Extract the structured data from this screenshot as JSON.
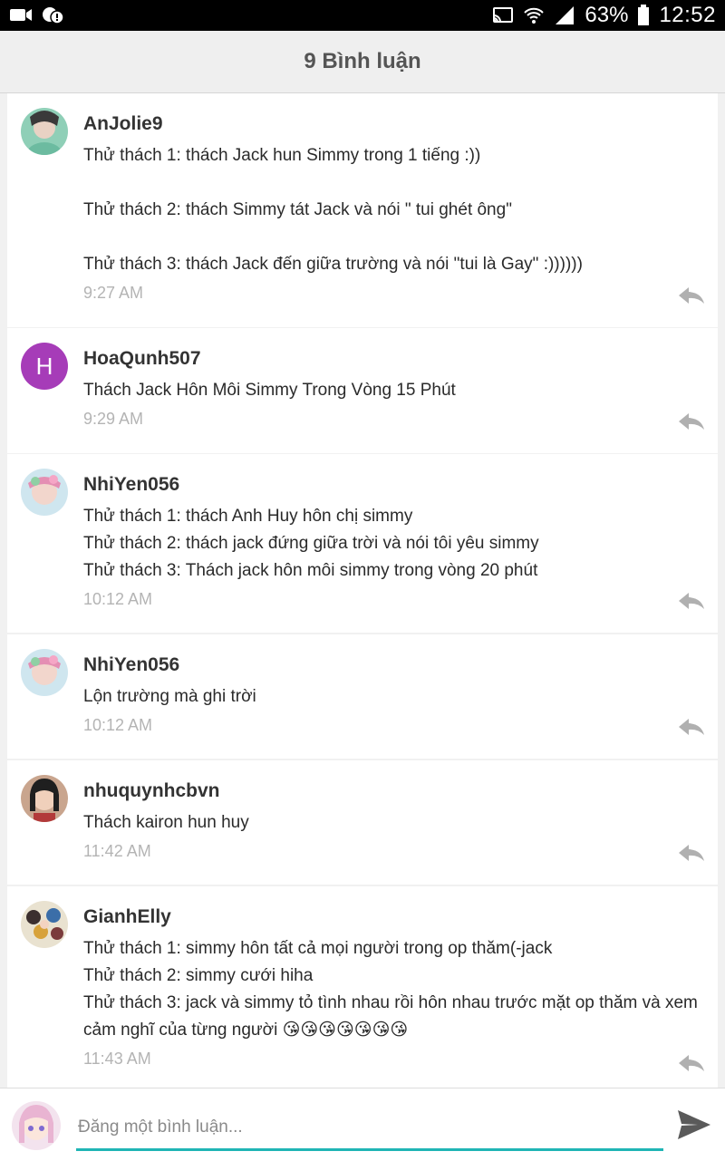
{
  "status_bar": {
    "battery_percent": "63%",
    "time": "12:52",
    "icons": [
      "video-icon",
      "notification-icon",
      "cast-icon",
      "wifi-icon",
      "signal-icon",
      "battery-icon"
    ]
  },
  "header": {
    "title": "9 Bình luận"
  },
  "comments": [
    {
      "username": "AnJolie9",
      "text": "Thử thách 1: thách Jack hun Simmy trong 1 tiếng :))\n\nThử thách 2: thách Simmy tát Jack và nói \" tui ghét ông\"\n\nThử thách 3: thách Jack đến giữa trường và nói \"tui là Gay\" :))))))",
      "time": "9:27 AM",
      "avatar": "photo"
    },
    {
      "username": "HoaQunh507",
      "text": "Thách Jack Hôn Môi Simmy Trong Vòng 15 Phút",
      "time": "9:29 AM",
      "avatar_letter": "H",
      "avatar_color": "#a63cb8"
    },
    {
      "username": "NhiYen056",
      "text": "Thử thách 1: thách Anh Huy hôn chị simmy\nThử thách 2: thách jack đứng giữa trời và nói tôi yêu simmy\nThử thách 3: Thách jack hôn môi simmy trong vòng 20 phút",
      "time": "10:12 AM",
      "avatar": "photo"
    },
    {
      "username": "NhiYen056",
      "text": "Lộn trường mà ghi trời",
      "time": "10:12 AM",
      "avatar": "photo"
    },
    {
      "username": "nhuquynhcbvn",
      "text": "Thách kairon hun huy",
      "time": "11:42 AM",
      "avatar": "photo"
    },
    {
      "username": "GianhElly",
      "text": "Thử thách 1: simmy hôn tất cả mọi người trong op thăm(-jack\nThử thách 2: simmy cưới hiha\nThử thách 3: jack và simmy tỏ tình nhau rồi hôn nhau trước mặt op thăm và xem cảm nghĩ của từng người 😘😘😘😘😘😘😘",
      "time": "11:43 AM",
      "avatar": "photo"
    }
  ],
  "composer": {
    "placeholder": "Đăng một bình luận..."
  },
  "colors": {
    "accent": "#1fb5b5",
    "avatar_purple": "#a63cb8",
    "timestamp": "#b4b4b4"
  }
}
